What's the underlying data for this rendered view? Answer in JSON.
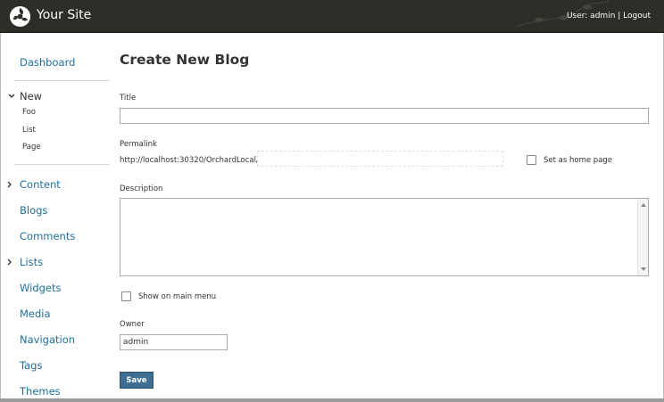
{
  "header": {
    "site_name": "Your Site",
    "user_prefix": "User: ",
    "user_name": "admin",
    "separator": " | ",
    "logout": "Logout",
    "bg_color": "#2d2e27"
  },
  "sidebar": {
    "dashboard": "Dashboard",
    "new_group": {
      "label": "New",
      "items": [
        "Foo",
        "List",
        "Page"
      ]
    },
    "items": [
      "Content",
      "Blogs",
      "Comments",
      "Lists",
      "Widgets",
      "Media",
      "Navigation",
      "Tags",
      "Themes"
    ],
    "link_color": "#1e6f9a"
  },
  "form": {
    "page_title": "Create New Blog",
    "title_label": "Title",
    "title_value": "",
    "permalink_label": "Permalink",
    "permalink_prefix": "http://localhost:30320/OrchardLocal/",
    "permalink_value": "",
    "home_page_label": "Set as home page",
    "home_page_checked": false,
    "description_label": "Description",
    "description_value": "",
    "main_menu_label": "Show on main menu",
    "main_menu_checked": false,
    "owner_label": "Owner",
    "owner_value": "admin",
    "save_label": "Save",
    "button_color": "#3e6f92"
  }
}
